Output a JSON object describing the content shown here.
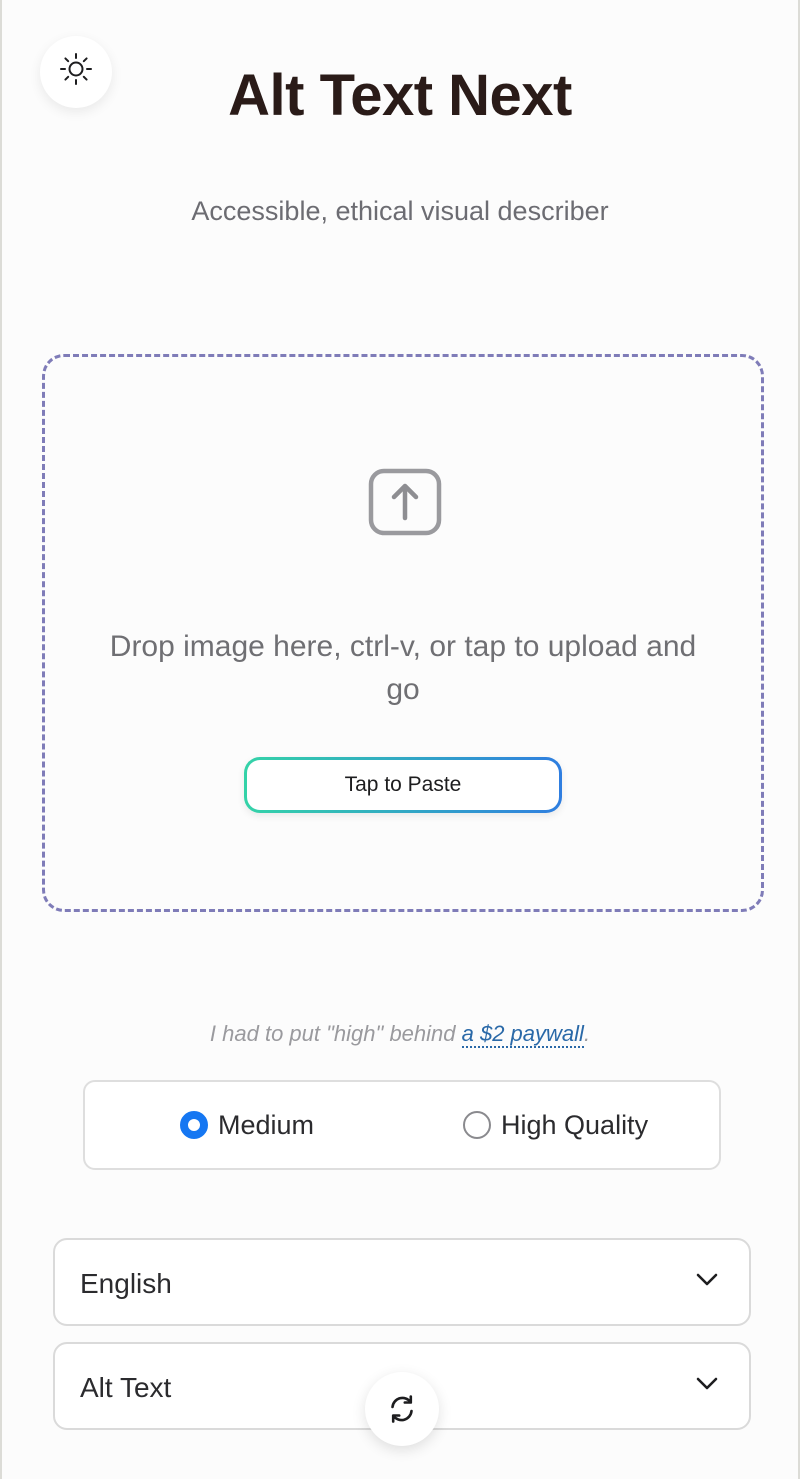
{
  "header": {
    "title": "Alt Text Next",
    "subtitle": "Accessible, ethical visual describer",
    "theme_icon": "sun-icon"
  },
  "dropzone": {
    "icon": "upload-icon",
    "instructions": "Drop image here, ctrl-v, or tap to upload and go",
    "paste_button_label": "Tap to Paste"
  },
  "quality": {
    "note_prefix": "I had to put \"high\" behind ",
    "note_link": "a $2 paywall",
    "note_suffix": ".",
    "options": [
      {
        "label": "Medium",
        "selected": true
      },
      {
        "label": "High Quality",
        "selected": false
      }
    ]
  },
  "language_select": {
    "value": "English"
  },
  "output_select": {
    "value": "Alt Text"
  },
  "refresh_icon": "refresh-icon",
  "colors": {
    "accent": "#1577f2",
    "dropzone_border": "#7f7cb8",
    "title": "#2a1b18",
    "link": "#2a69a8"
  }
}
